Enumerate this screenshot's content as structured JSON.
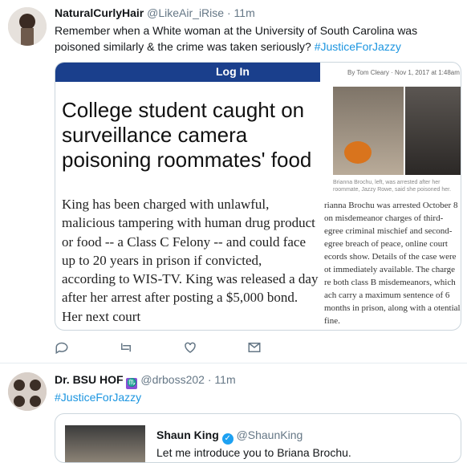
{
  "tweet1": {
    "display_name": "NaturalCurlyHair",
    "handle": "@LikeAir_iRise",
    "separator": "·",
    "time": "11m",
    "text": "Remember when a White woman at the University of South Carolina was poisoned similarly & the crime was taken seriously?",
    "hashtag": "#JusticeForJazzy",
    "media": {
      "nav_text": "Log In",
      "byline": "By Tom Cleary · Nov 1, 2017 at 1:48am",
      "headline": "College student caught on surveillance camera poisoning roommates' food",
      "caption": "Brianna Brochu, left, was arrested after her roommate, Jazzy Rowe, said she poisoned her.",
      "article_left": "King has been charged with unlawful, malicious tampering with human drug product or food -- a Class C Felony -- and could face up to 20 years in prison if convicted, according to WIS-TV. King was released a day after her arrest after posting a $5,000 bond. Her next court",
      "article_right": "rianna Brochu was arrested October 8 on misdemeanor charges of third-egree criminal mischief and second-egree breach of peace, online court ecords show. Details of the case were ot immediately available. The charge re both class B misdemeanors, which ach carry a maximum sentence of 6 months in prison, along with a otential fine."
    },
    "actions": [
      "reply-icon",
      "retweet-icon",
      "like-icon",
      "dm-icon"
    ]
  },
  "tweet2": {
    "display_name": "Dr. BSU HOF",
    "sign": "♏",
    "handle": "@drboss202",
    "separator": "·",
    "time": "11m",
    "hashtag": "#JusticeForJazzy",
    "quote": {
      "name": "Shaun King",
      "handle": "@ShaunKing",
      "text": "Let me introduce you to Briana Brochu."
    }
  }
}
